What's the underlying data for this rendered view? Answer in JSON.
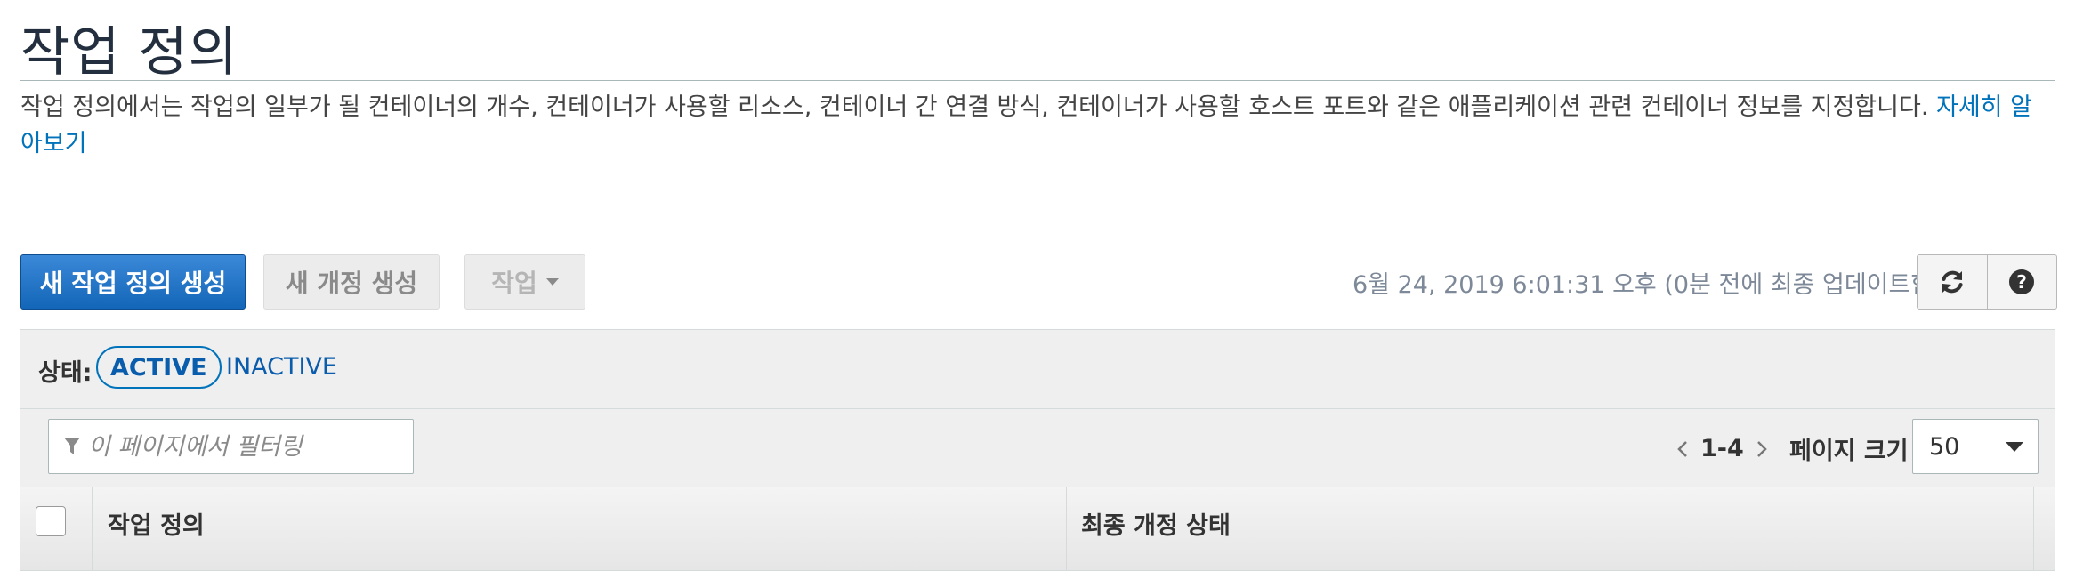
{
  "page": {
    "title": "작업 정의",
    "description": "작업 정의에서는 작업의 일부가 될 컨테이너의 개수, 컨테이너가 사용할 리소스, 컨테이너 간 연결 방식, 컨테이너가 사용할 호스트 포트와 같은 애플리케이션 관련 컨테이너 정보를 지정합니다.",
    "learn_more": "자세히 알아보기"
  },
  "toolbar": {
    "create_button": "새 작업 정의 생성",
    "new_revision_button": "새 개정 생성",
    "actions_button": "작업",
    "last_updated": "6월 24, 2019 6:01:31 오후 (0분 전에 최종 업데이트함"
  },
  "status_filter": {
    "label": "상태:",
    "active": "ACTIVE",
    "inactive": "INACTIVE"
  },
  "filter": {
    "placeholder": "이 페이지에서 필터링"
  },
  "pagination": {
    "range": "1-4",
    "page_size_label": "페이지 크기",
    "page_size_value": "50"
  },
  "table": {
    "columns": [
      "작업 정의",
      "최종 개정 상태"
    ]
  },
  "colors": {
    "primary": "#1366b8",
    "link": "#0073bb"
  },
  "icons": [
    "refresh-icon",
    "help-icon",
    "filter-icon",
    "chevron-left-icon",
    "chevron-right-icon",
    "caret-down-icon"
  ]
}
